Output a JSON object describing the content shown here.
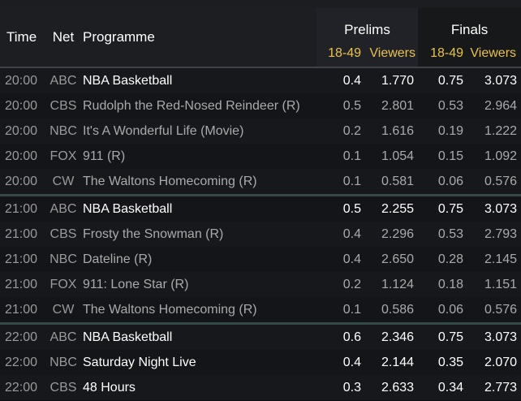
{
  "header": {
    "col_time": "Time",
    "col_net": "Net",
    "col_programme": "Programme",
    "group_prelims": "Prelims",
    "group_finals": "Finals",
    "sub_demo_prelims": "18-49",
    "sub_viewers_prelims": "Viewers",
    "sub_demo_finals": "18-49",
    "sub_viewers_finals": "Viewers"
  },
  "rows": [
    {
      "time": "20:00",
      "net": "ABC",
      "programme": "NBA Basketball",
      "pre_demo": "0.4",
      "pre_viewers": "1.770",
      "fin_demo": "0.75",
      "fin_viewers": "3.073"
    },
    {
      "time": "20:00",
      "net": "CBS",
      "programme": "Rudolph the Red-Nosed Reindeer (R)",
      "pre_demo": "0.5",
      "pre_viewers": "2.801",
      "fin_demo": "0.53",
      "fin_viewers": "2.964"
    },
    {
      "time": "20:00",
      "net": "NBC",
      "programme": "It's A Wonderful Life (Movie)",
      "pre_demo": "0.2",
      "pre_viewers": "1.616",
      "fin_demo": "0.19",
      "fin_viewers": "1.222"
    },
    {
      "time": "20:00",
      "net": "FOX",
      "programme": "911 (R)",
      "pre_demo": "0.1",
      "pre_viewers": "1.054",
      "fin_demo": "0.15",
      "fin_viewers": "1.092"
    },
    {
      "time": "20:00",
      "net": "CW",
      "programme": "The Waltons Homecoming (R)",
      "pre_demo": "0.1",
      "pre_viewers": "0.581",
      "fin_demo": "0.06",
      "fin_viewers": "0.576"
    },
    {
      "time": "21:00",
      "net": "ABC",
      "programme": "NBA Basketball",
      "pre_demo": "0.5",
      "pre_viewers": "2.255",
      "fin_demo": "0.75",
      "fin_viewers": "3.073"
    },
    {
      "time": "21:00",
      "net": "CBS",
      "programme": "Frosty the Snowman (R)",
      "pre_demo": "0.4",
      "pre_viewers": "2.296",
      "fin_demo": "0.53",
      "fin_viewers": "2.793"
    },
    {
      "time": "21:00",
      "net": "NBC",
      "programme": "Dateline (R)",
      "pre_demo": "0.4",
      "pre_viewers": "2.650",
      "fin_demo": "0.28",
      "fin_viewers": "2.145"
    },
    {
      "time": "21:00",
      "net": "FOX",
      "programme": "911: Lone Star (R)",
      "pre_demo": "0.2",
      "pre_viewers": "1.124",
      "fin_demo": "0.18",
      "fin_viewers": "1.151"
    },
    {
      "time": "21:00",
      "net": "CW",
      "programme": "The Waltons Homecoming (R)",
      "pre_demo": "0.1",
      "pre_viewers": "0.586",
      "fin_demo": "0.06",
      "fin_viewers": "0.576"
    },
    {
      "time": "22:00",
      "net": "ABC",
      "programme": "NBA Basketball",
      "pre_demo": "0.6",
      "pre_viewers": "2.346",
      "fin_demo": "0.75",
      "fin_viewers": "3.073"
    },
    {
      "time": "22:00",
      "net": "NBC",
      "programme": "Saturday Night Live",
      "pre_demo": "0.4",
      "pre_viewers": "2.144",
      "fin_demo": "0.35",
      "fin_viewers": "2.070"
    },
    {
      "time": "22:00",
      "net": "CBS",
      "programme": "48 Hours",
      "pre_demo": "0.3",
      "pre_viewers": "2.633",
      "fin_demo": "0.34",
      "fin_viewers": "2.773"
    }
  ]
}
